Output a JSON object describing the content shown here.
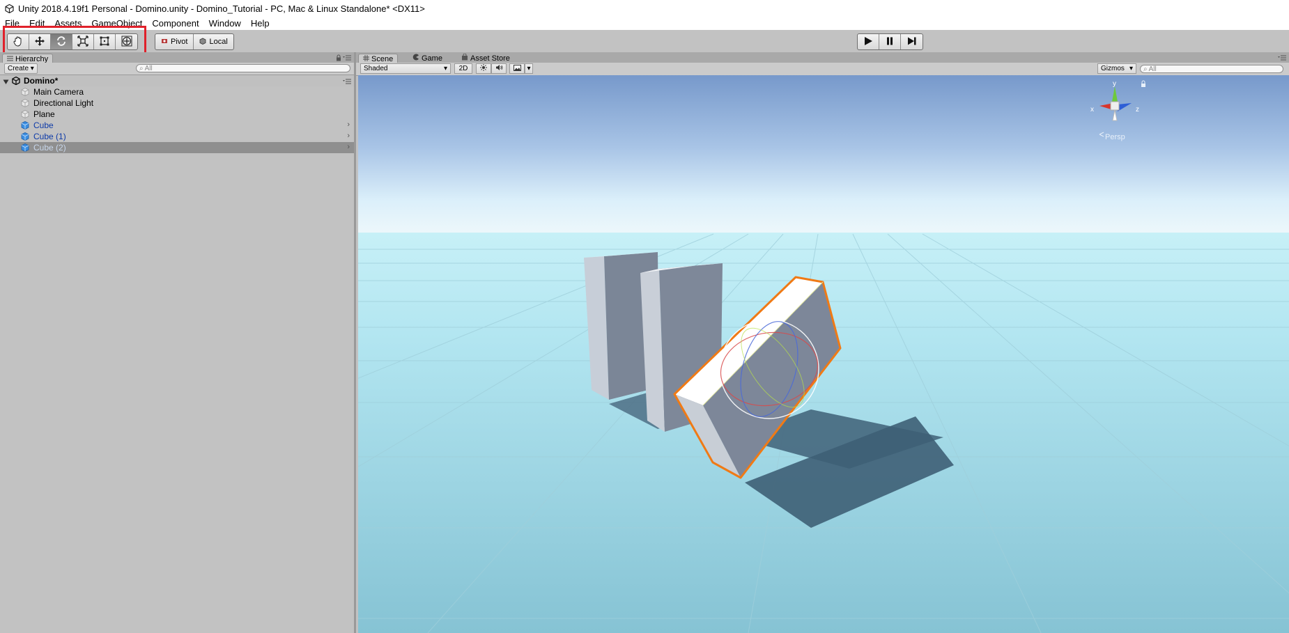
{
  "window": {
    "title": "Unity 2018.4.19f1 Personal - Domino.unity - Domino_Tutorial - PC, Mac & Linux Standalone* <DX11>"
  },
  "menu": [
    "File",
    "Edit",
    "Assets",
    "GameObject",
    "Component",
    "Window",
    "Help"
  ],
  "toolbar": {
    "tools": [
      "hand-tool",
      "move-tool",
      "rotate-tool",
      "scale-tool",
      "rect-tool",
      "transform-tool"
    ],
    "active_tool": "rotate-tool",
    "pivot_label": "Pivot",
    "local_label": "Local"
  },
  "hierarchy": {
    "tab_label": "Hierarchy",
    "create_label": "Create",
    "search_placeholder": "All",
    "scene_name": "Domino*",
    "items": [
      {
        "label": "Main Camera",
        "prefab": false
      },
      {
        "label": "Directional Light",
        "prefab": false
      },
      {
        "label": "Plane",
        "prefab": false
      },
      {
        "label": "Cube",
        "prefab": true
      },
      {
        "label": "Cube (1)",
        "prefab": true
      },
      {
        "label": "Cube (2)",
        "prefab": true,
        "selected": true
      }
    ]
  },
  "scene": {
    "tabs": [
      "Scene",
      "Game",
      "Asset Store"
    ],
    "active_tab": "Scene",
    "shading_mode": "Shaded",
    "mode_2d_label": "2D",
    "gizmos_label": "Gizmos",
    "search_placeholder": "All",
    "projection_label": "Persp",
    "axis_labels": {
      "x": "x",
      "y": "y",
      "z": "z"
    }
  },
  "colors": {
    "selection_outline": "#f07a15",
    "highlight_box": "#e0212b",
    "panel_bg": "#c2c2c2"
  }
}
